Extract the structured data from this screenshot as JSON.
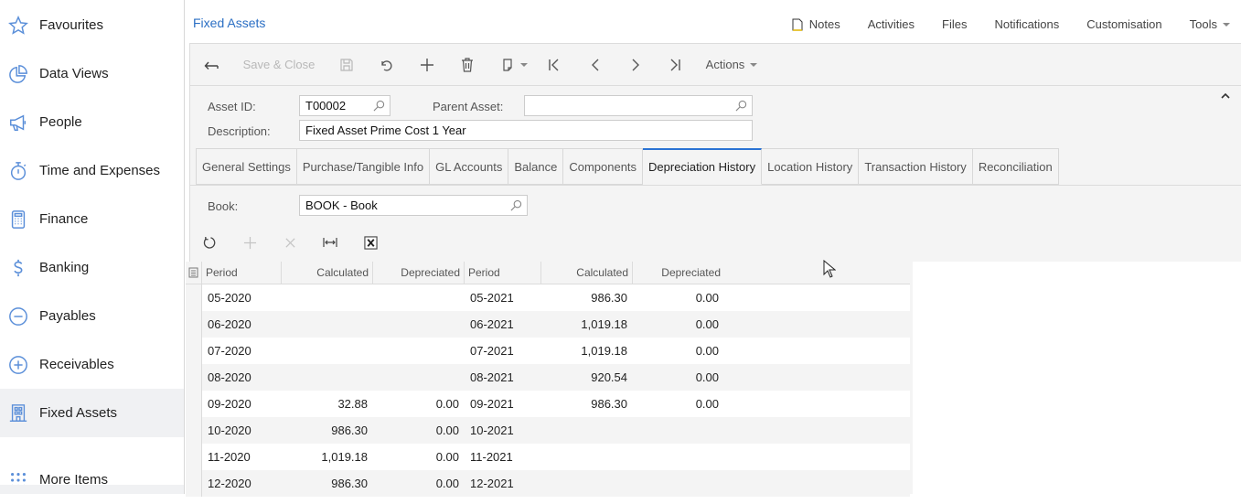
{
  "sidebar": {
    "items": [
      {
        "label": "Favourites",
        "icon": "star-icon"
      },
      {
        "label": "Data Views",
        "icon": "pie-chart-icon"
      },
      {
        "label": "People",
        "icon": "megaphone-icon"
      },
      {
        "label": "Time and Expenses",
        "icon": "stopwatch-icon"
      },
      {
        "label": "Finance",
        "icon": "calculator-icon"
      },
      {
        "label": "Banking",
        "icon": "dollar-icon"
      },
      {
        "label": "Payables",
        "icon": "minus-circle-icon"
      },
      {
        "label": "Receivables",
        "icon": "plus-circle-icon"
      },
      {
        "label": "Fixed Assets",
        "icon": "building-icon",
        "active": true
      },
      {
        "label": "More Items",
        "icon": "dots-grid-icon"
      }
    ]
  },
  "header": {
    "title": "Fixed Assets",
    "links": {
      "notes": "Notes",
      "activities": "Activities",
      "files": "Files",
      "notifications": "Notifications",
      "customisation": "Customisation",
      "tools": "Tools"
    }
  },
  "toolbar": {
    "save_close": "Save & Close",
    "actions": "Actions"
  },
  "form": {
    "asset_id_label": "Asset ID:",
    "asset_id_value": "T00002",
    "parent_asset_label": "Parent Asset:",
    "parent_asset_value": "",
    "description_label": "Description:",
    "description_value": "Fixed Asset Prime Cost 1 Year"
  },
  "tabs": [
    {
      "label": "General Settings"
    },
    {
      "label": "Purchase/Tangible Info"
    },
    {
      "label": "GL Accounts"
    },
    {
      "label": "Balance"
    },
    {
      "label": "Components"
    },
    {
      "label": "Depreciation History",
      "active": true
    },
    {
      "label": "Location History"
    },
    {
      "label": "Transaction History"
    },
    {
      "label": "Reconciliation"
    }
  ],
  "book": {
    "label": "Book:",
    "value": "BOOK - Book"
  },
  "grid": {
    "columns": [
      "Period",
      "Calculated",
      "Depreciated",
      "Period",
      "Calculated",
      "Depreciated"
    ],
    "rows": [
      [
        "05-2020",
        "",
        "",
        "05-2021",
        "986.30",
        "0.00"
      ],
      [
        "06-2020",
        "",
        "",
        "06-2021",
        "1,019.18",
        "0.00"
      ],
      [
        "07-2020",
        "",
        "",
        "07-2021",
        "1,019.18",
        "0.00"
      ],
      [
        "08-2020",
        "",
        "",
        "08-2021",
        "920.54",
        "0.00"
      ],
      [
        "09-2020",
        "32.88",
        "0.00",
        "09-2021",
        "986.30",
        "0.00"
      ],
      [
        "10-2020",
        "986.30",
        "0.00",
        "10-2021",
        "",
        ""
      ],
      [
        "11-2020",
        "1,019.18",
        "0.00",
        "11-2021",
        "",
        ""
      ],
      [
        "12-2020",
        "986.30",
        "0.00",
        "12-2021",
        "",
        ""
      ]
    ]
  },
  "colors": {
    "accent": "#2b73d4",
    "title": "#2b6fc4",
    "icon": "#5b8fd9"
  }
}
